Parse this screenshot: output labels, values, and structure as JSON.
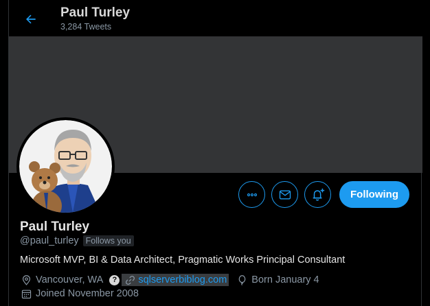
{
  "header": {
    "title": "Paul Turley",
    "tweet_count": "3,284 Tweets"
  },
  "profile": {
    "name": "Paul Turley",
    "handle": "@paul_turley",
    "follows_you": "Follows you",
    "bio": "Microsoft MVP, BI & Data Architect, Pragmatic Works Principal Consultant",
    "location": "Vancouver, WA",
    "help_badge": "?",
    "website": "sqlserverbiblog.com",
    "birthday": "Born January 4",
    "joined": "Joined November 2008"
  },
  "actions": {
    "following_label": "Following"
  },
  "icons": {
    "back": "arrow-left-icon",
    "more": "more-horizontal-icon",
    "message": "envelope-icon",
    "notify": "bell-plus-icon",
    "location": "location-pin-icon",
    "link": "link-icon",
    "birthday": "balloon-icon",
    "calendar": "calendar-icon"
  },
  "colors": {
    "accent": "#1d9bf0",
    "background": "#000000",
    "banner": "#333436",
    "muted_text": "#8b98a5"
  }
}
